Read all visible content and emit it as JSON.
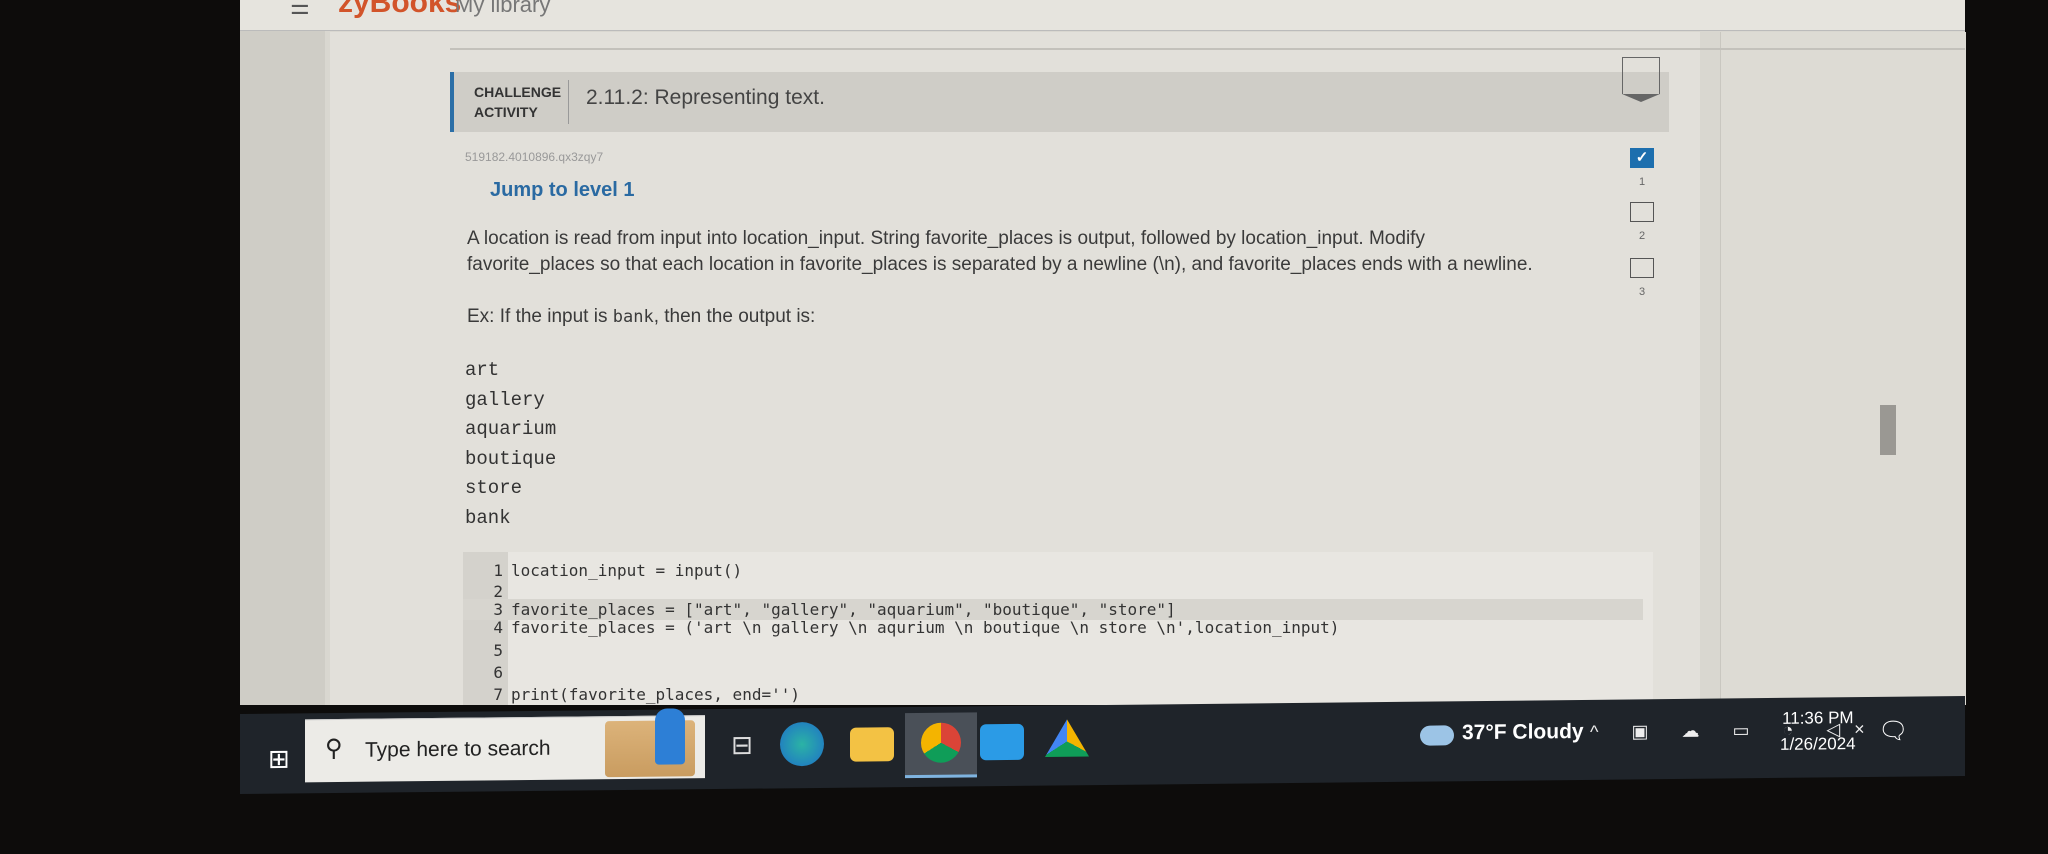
{
  "header": {
    "brand": "zyBooks",
    "breadcrumb": "My library"
  },
  "activity": {
    "label_line1": "CHALLENGE",
    "label_line2": "ACTIVITY",
    "title": "2.11.2: Representing text.",
    "id": "519182.4010896.qx3zqy7",
    "jump": "Jump to level 1"
  },
  "levels": [
    {
      "num": "1",
      "done": true
    },
    {
      "num": "2",
      "done": false
    },
    {
      "num": "3",
      "done": false
    }
  ],
  "prompt": {
    "line1": "A location is read from input into location_input. String favorite_places is output, followed by location_input. Modify",
    "line2": "favorite_places so that each location in favorite_places is separated by a newline (\\n), and favorite_places ends with a newline.",
    "ex_pre": "Ex: If the input is ",
    "ex_code": "bank",
    "ex_post": ", then the output is:"
  },
  "output": [
    "art",
    "gallery",
    "aquarium",
    "boutique",
    "store",
    "bank"
  ],
  "code": [
    {
      "n": "1",
      "text": "location_input = input()"
    },
    {
      "n": "2",
      "text": ""
    },
    {
      "n": "3",
      "text": "favorite_places = [\"art\", \"gallery\", \"aquarium\", \"boutique\", \"store\"]"
    },
    {
      "n": "4",
      "text": "favorite_places = ('art \\n gallery \\n aqurium \\n boutique \\n store \\n',location_input)"
    },
    {
      "n": "5",
      "text": ""
    },
    {
      "n": "6",
      "text": ""
    },
    {
      "n": "7",
      "text": "print(favorite_places, end='')"
    }
  ],
  "taskbar": {
    "search_placeholder": "Type here to search",
    "weather": "37°F  Cloudy",
    "time": "11:36 PM",
    "date": "1/26/2024",
    "apps": [
      "task-view",
      "edge",
      "file-explorer",
      "chrome",
      "mail",
      "google-drive"
    ]
  },
  "colors": {
    "accent": "#2c6fa7",
    "taskbar": "#1f242a"
  }
}
